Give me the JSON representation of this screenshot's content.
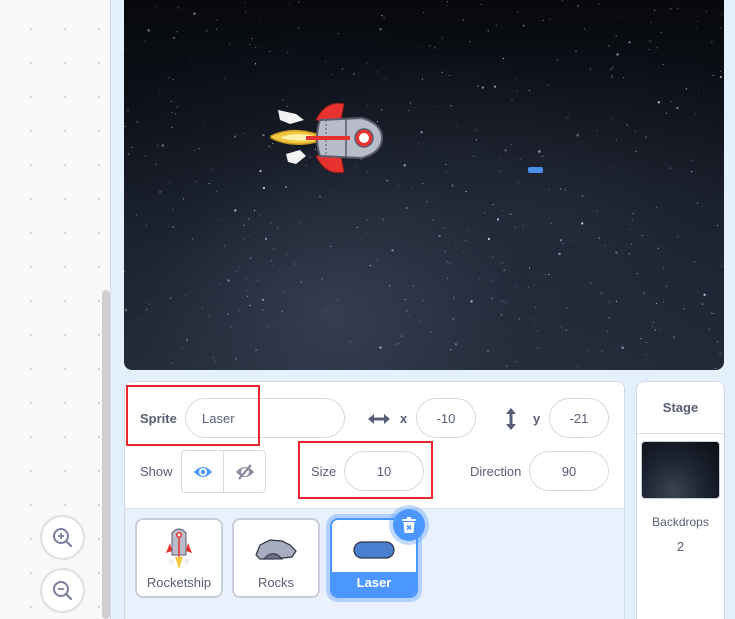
{
  "workspace": {
    "zoom_in_icon": "zoom-in-icon",
    "zoom_out_icon": "zoom-out-icon"
  },
  "stage": {
    "sprites_visible": [
      "Rocketship",
      "Laser"
    ]
  },
  "sprite_info": {
    "sprite_label": "Sprite",
    "sprite_name": "Laser",
    "x_label": "x",
    "x_value": "-10",
    "y_label": "y",
    "y_value": "-21",
    "show_label": "Show",
    "show_visible_icon": "eye-icon",
    "show_hidden_icon": "eye-slash-icon",
    "size_label": "Size",
    "size_value": "10",
    "direction_label": "Direction",
    "direction_value": "90"
  },
  "sprite_list": [
    {
      "name": "Rocketship",
      "selected": false
    },
    {
      "name": "Rocks",
      "selected": false
    },
    {
      "name": "Laser",
      "selected": true
    }
  ],
  "stage_pane": {
    "title": "Stage",
    "backdrops_label": "Backdrops",
    "backdrops_count": "2"
  },
  "colors": {
    "accent": "#4c97ff",
    "highlight_box": "#e8272f",
    "text": "#575e75"
  }
}
